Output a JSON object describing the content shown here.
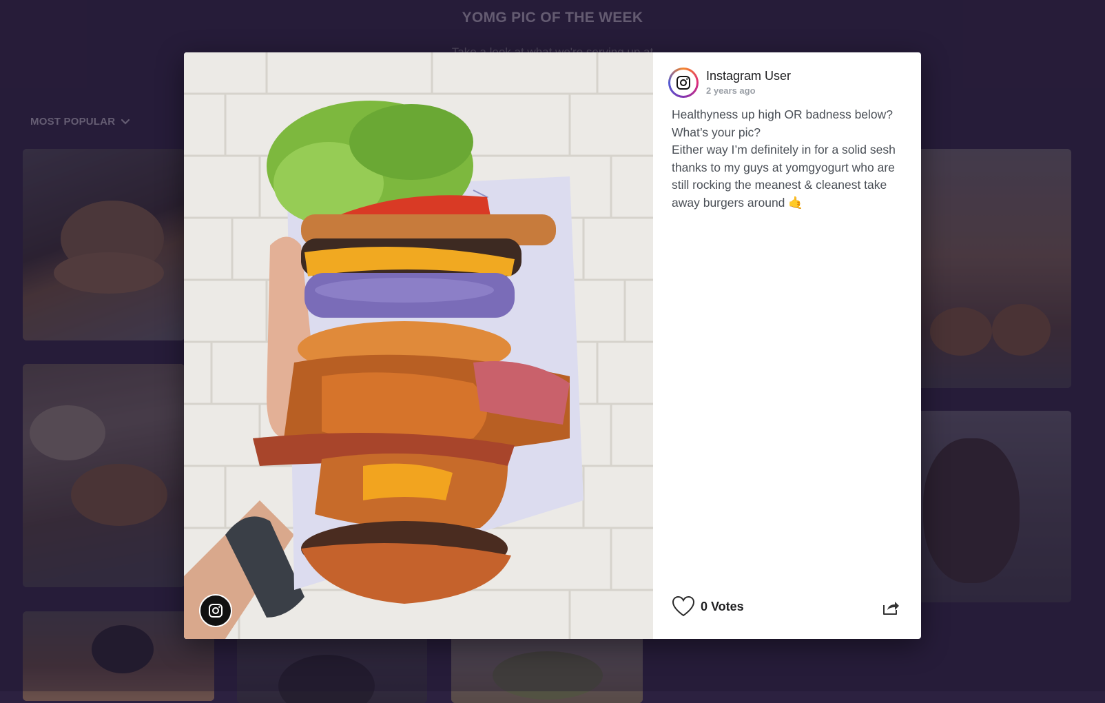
{
  "page": {
    "title": "YOMG PIC OF THE WEEK",
    "subtitle": "Take a look at what we're serving up at"
  },
  "filter": {
    "sort_label": "MOST POPULAR"
  },
  "post": {
    "user_name": "Instagram User",
    "time": "2 years ago",
    "caption_lines": [
      "Healthyness up high OR badness below?",
      "What’s your pic?",
      "Either way I’m definitely in for a solid sesh thanks to my guys at yomgyogurt who are still rocking the meanest & cleanest take away burgers around 🤙"
    ],
    "votes_label": "0 Votes"
  },
  "icons": {
    "source_badge": "instagram-icon",
    "vote": "heart-outline-icon",
    "share": "share-icon",
    "sort": "chevron-down-icon"
  },
  "colors": {
    "page_background": "#2c2140",
    "modal_background": "#ffffff",
    "caption_text": "#4a4f56"
  }
}
